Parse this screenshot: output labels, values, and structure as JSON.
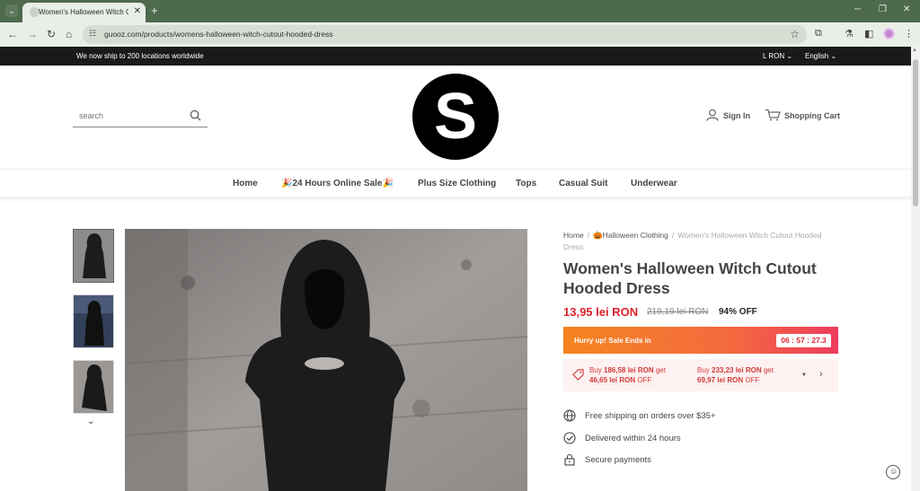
{
  "browser": {
    "tab_title": "Women's Halloween Witch Cu",
    "tab_close": "✕",
    "new_tab": "+",
    "url": "guooz.com/products/womens-halloween-witch-cutout-hooded-dress",
    "icons": [
      "tab-search-icon",
      "back-icon",
      "forward-icon",
      "reload-icon",
      "home-icon",
      "site-settings-icon",
      "bookmark-star-icon",
      "extensions-icon",
      "labs-icon",
      "side-panel-icon",
      "profile-avatar-icon",
      "menu-icon"
    ]
  },
  "announcement": {
    "text": "We now ship to 200 locations worldwide",
    "currency": "L RON",
    "language": "English"
  },
  "header": {
    "search_placeholder": "search",
    "logo_letter": "S",
    "sign_in": "Sign In",
    "cart": "Shopping Cart"
  },
  "nav": {
    "items": [
      "Home",
      "🎉24 Hours Online Sale🎉",
      "Plus Size Clothing",
      "Tops",
      "Casual Suit",
      "Underwear"
    ]
  },
  "breadcrumb": {
    "home": "Home",
    "category": "🎃Halloween Clothing",
    "current": "Women's Halloween Witch Cutout Hooded Dress",
    "separator": "/"
  },
  "product": {
    "title": "Women's Halloween Witch Cutout Hooded Dress",
    "price": "13,95 lei RON",
    "original_price": "219,19 lei RON",
    "discount": "94% OFF",
    "sale_text": "Hurry up! Sale Ends in",
    "timer": "06 : 57 : 27.3",
    "promo1_a": "Buy ",
    "promo1_amount": "186,58 lei RON",
    "promo1_b": " get",
    "promo1_off": "46,65 lei RON",
    "promo1_c": " OFF",
    "promo2_a": "Buy ",
    "promo2_amount": "233,23 lei RON",
    "promo2_b": " get",
    "promo2_off": "69,97 lei RON",
    "promo2_c": " OFF"
  },
  "features": [
    "Free shipping on orders over $35+",
    "Delivered within 24 hours",
    "Secure payments"
  ],
  "colors": {
    "accent_red": "#e0232b",
    "sale_gradient_start": "#f5841f",
    "sale_gradient_end": "#ee3c5c",
    "tab_bar": "#4d6a4d"
  }
}
